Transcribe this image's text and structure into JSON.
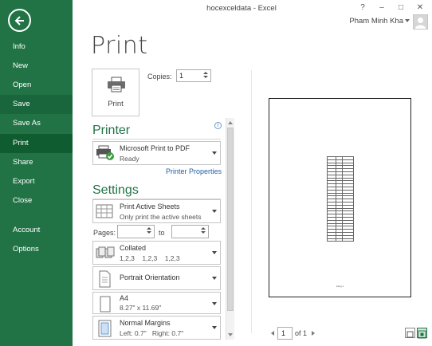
{
  "window": {
    "title": "hocexceldata - Excel",
    "help": "?",
    "minimize": "–",
    "restore": "□",
    "close": "✕",
    "user_name": "Pham Minh Kha"
  },
  "nav": {
    "items": [
      {
        "label": "Info"
      },
      {
        "label": "New"
      },
      {
        "label": "Open"
      },
      {
        "label": "Save"
      },
      {
        "label": "Save As"
      },
      {
        "label": "Print"
      },
      {
        "label": "Share"
      },
      {
        "label": "Export"
      },
      {
        "label": "Close"
      },
      {
        "label": "Account"
      },
      {
        "label": "Options"
      }
    ]
  },
  "print": {
    "heading": "Print",
    "button_label": "Print",
    "copies_label": "Copies:",
    "copies_value": "1"
  },
  "printer": {
    "heading": "Printer",
    "name": "Microsoft Print to PDF",
    "status": "Ready",
    "properties_link": "Printer Properties"
  },
  "settings": {
    "heading": "Settings",
    "what": {
      "title": "Print Active Sheets",
      "subtitle": "Only print the active sheets"
    },
    "pages_label": "Pages:",
    "to_label": "to",
    "pages_from": "",
    "pages_to": "",
    "collation": {
      "title": "Collated",
      "subtitle": "1,2,3    1,2,3    1,2,3"
    },
    "orientation": {
      "title": "Portrait Orientation"
    },
    "paper": {
      "title": "A4",
      "subtitle": "8.27\" x 11.69\""
    },
    "margins": {
      "title": "Normal Margins",
      "subtitle": "Left: 0.7\"   Right: 0.7\""
    }
  },
  "preview": {
    "current_page": "1",
    "of_label": "of 1",
    "footer_text": "trang 1"
  },
  "colors": {
    "accent": "#217346",
    "nav_active": "#0e5c2f",
    "link": "#1f5fa9"
  }
}
